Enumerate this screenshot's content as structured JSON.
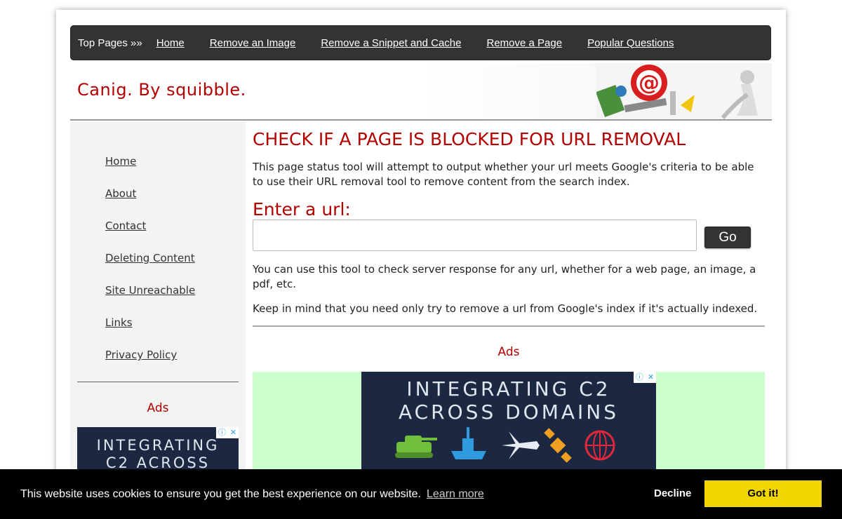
{
  "topnav": {
    "lead": "Top Pages »»",
    "links": [
      "Home",
      "Remove an Image",
      "Remove a Snippet and Cache",
      "Remove a Page",
      "Popular Questions"
    ]
  },
  "header": {
    "site_title": "Canig. By squibble."
  },
  "sidebar": {
    "links": [
      "Home",
      "About",
      "Contact",
      "Deleting Content",
      "Site Unreachable",
      "Links",
      "Privacy Policy"
    ],
    "ads_title": "Ads",
    "ad_lines": [
      "INTEGRATING",
      "C2 ACROSS"
    ]
  },
  "main": {
    "title": "CHECK IF A PAGE IS BLOCKED FOR URL REMOVAL",
    "intro": "This page status tool will attempt to output whether your url meets Google's criteria to be able to use their URL removal tool to remove content from the search index.",
    "enter_label": "Enter a url:",
    "url_value": "",
    "go_label": "Go",
    "p1": "You can use this tool to check server response for any url, whether for a web page, an image, a pdf, etc.",
    "p2": "Keep in mind that you need only try to remove a url from Google's index if it's actually indexed.",
    "ads_title": "Ads",
    "ad_lines": [
      "INTEGRATING C2",
      "ACROSS DOMAINS"
    ]
  },
  "cookie": {
    "message": "This website uses cookies to ensure you get the best experience on our website.",
    "learn_more": "Learn more",
    "decline": "Decline",
    "accept": "Got it!"
  },
  "colors": {
    "accent_red": "#b30000",
    "nav_dark": "#333333",
    "cookie_button": "#f1d600",
    "ad_bg": "#ccffcc"
  }
}
